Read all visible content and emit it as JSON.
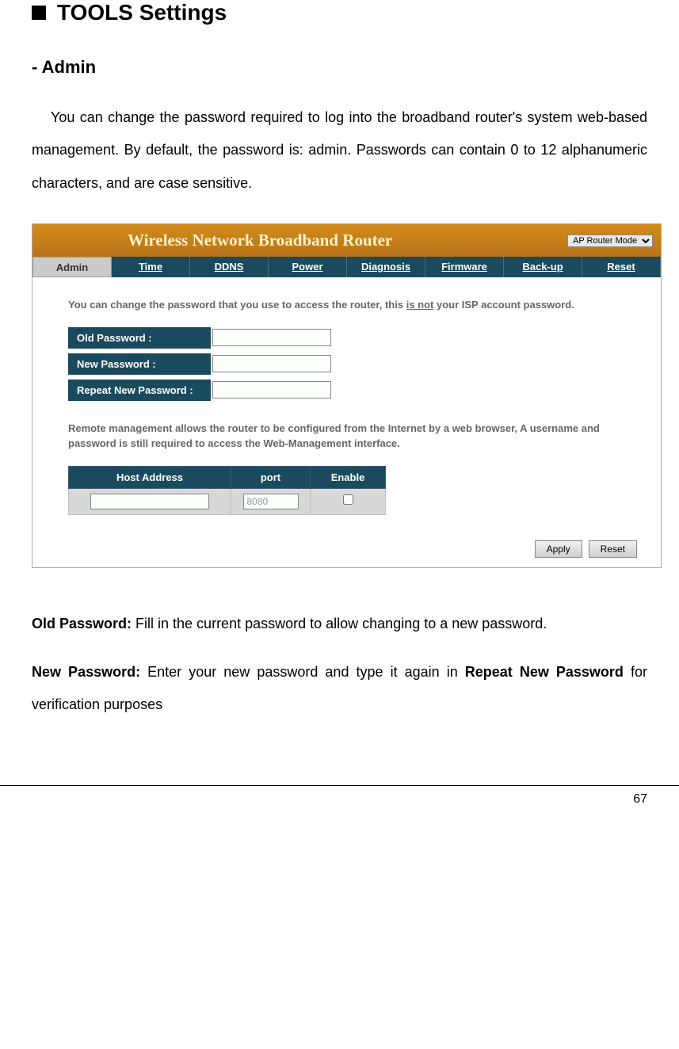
{
  "heading": "TOOLS Settings",
  "subheading": "- Admin",
  "intro": "You can change the password required to log into the broadband router's system web-based management. By default, the password is: admin. Passwords can contain 0 to 12 alphanumeric characters, and are case sensitive.",
  "router": {
    "title": "Wireless Network Broadband Router",
    "mode_selected": "AP Router Mode",
    "nav": [
      "Admin",
      "Time",
      "DDNS",
      "Power",
      "Diagnosis",
      "Firmware",
      "Back-up",
      "Reset"
    ],
    "info_text_1": "You can change the password that you use to access the router, this ",
    "info_text_underline": "is not",
    "info_text_2": " your ISP account password.",
    "fields": {
      "old_password": "Old Password :",
      "new_password": "New Password :",
      "repeat_password": "Repeat New Password :"
    },
    "remote_info": "Remote management allows the router to be configured from the Internet by a web browser, A username and password is still required to access the Web-Management interface.",
    "remote_headers": {
      "host": "Host Address",
      "port": "port",
      "enable": "Enable"
    },
    "remote_values": {
      "host": "",
      "port": "8080"
    },
    "buttons": {
      "apply": "Apply",
      "reset": "Reset"
    }
  },
  "definitions": {
    "old_password_label": "Old Password:",
    "old_password_text": " Fill in the current password to allow changing to a new password.",
    "new_password_label": "New Password:",
    "new_password_text": " Enter your new password and type it again in ",
    "repeat_label": "Repeat New Password",
    "verification_text": " for verification purposes"
  },
  "page_number": "67"
}
